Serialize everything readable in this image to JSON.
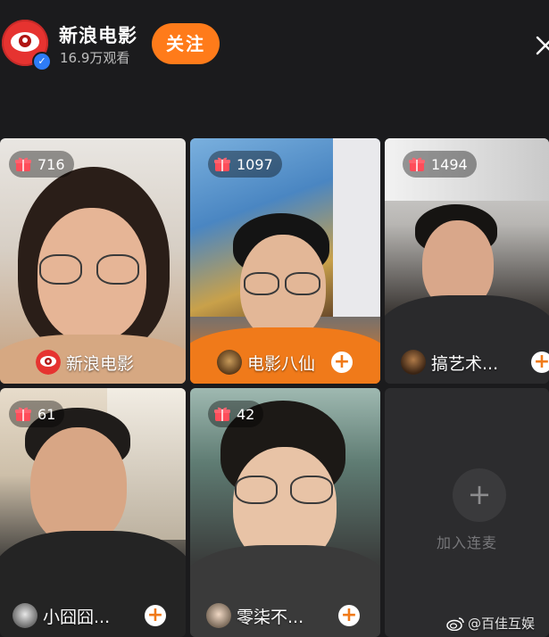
{
  "header": {
    "host_name": "新浪电影",
    "view_count": "16.9万观看",
    "follow_label": "关注",
    "verified_icon": "verified-badge-icon",
    "close_icon": "close-icon"
  },
  "guests": [
    {
      "gift_count": "716",
      "name": "新浪电影",
      "has_plus": false
    },
    {
      "gift_count": "1097",
      "name": "电影八仙",
      "has_plus": true
    },
    {
      "gift_count": "1494",
      "name": "搞艺术...",
      "has_plus": true
    },
    {
      "gift_count": "61",
      "name": "小囧囧...",
      "has_plus": true
    },
    {
      "gift_count": "42",
      "name": "零柒不...",
      "has_plus": true
    }
  ],
  "join_slot": {
    "plus_symbol": "+",
    "label": "加入连麦"
  },
  "watermark": {
    "text": "@百佳互娱"
  },
  "colors": {
    "accent": "#ff7b1a",
    "background": "#1b1b1d",
    "verified": "#2e7cf6"
  }
}
